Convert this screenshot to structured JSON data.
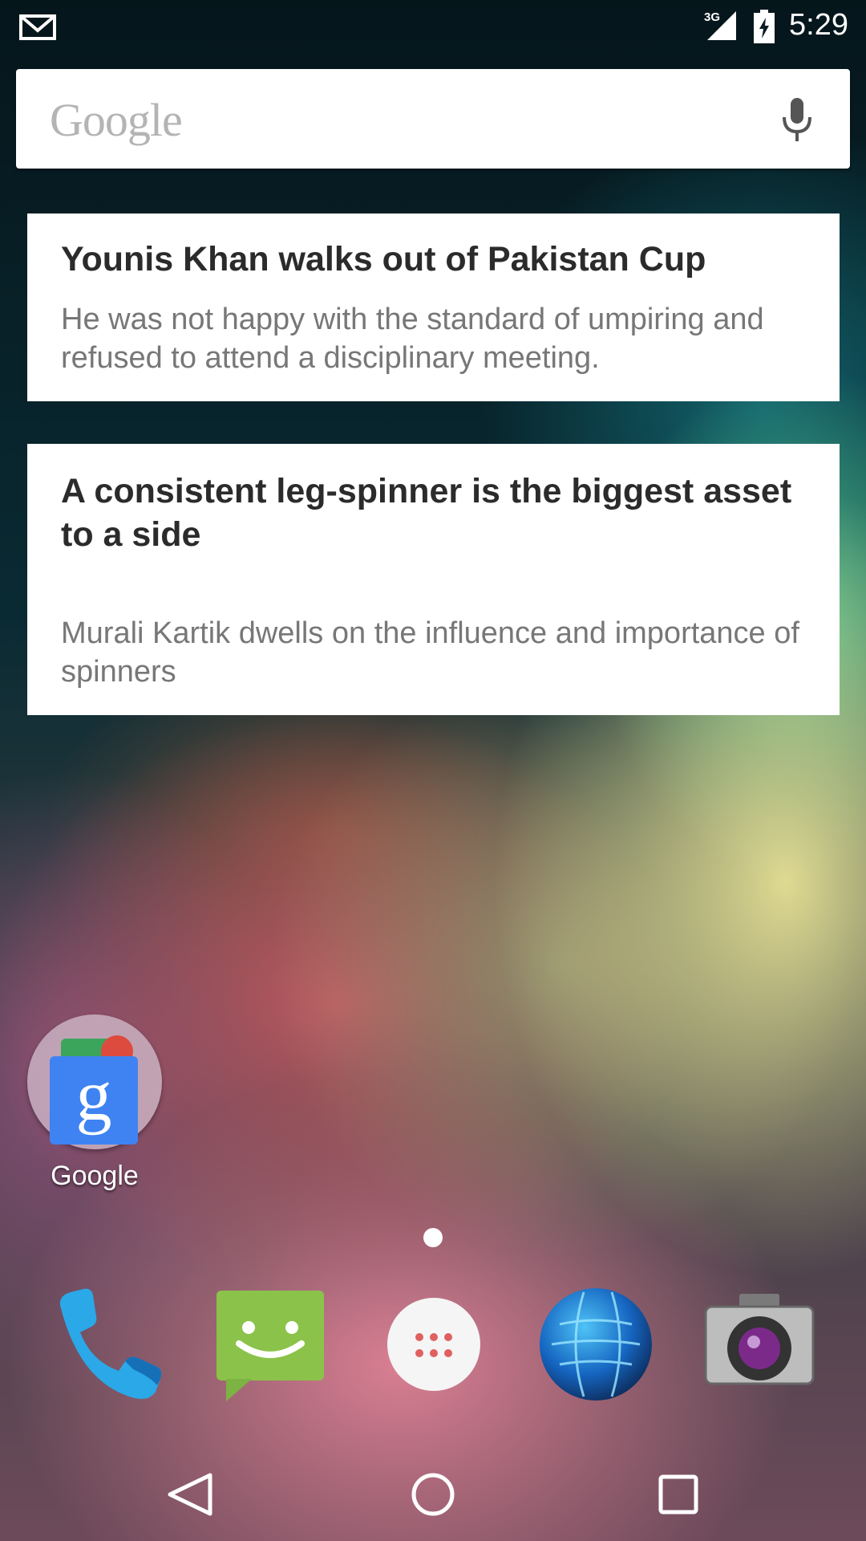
{
  "status_bar": {
    "network": "3G",
    "time": "5:29",
    "icons": [
      "mail-icon",
      "signal-icon",
      "battery-icon"
    ]
  },
  "search": {
    "logo_text": "Google",
    "icons": [
      "mic-icon"
    ]
  },
  "news_cards": [
    {
      "title": "Younis Khan walks out of Pakistan Cup",
      "text": "He was not happy with the standard of umpiring and refused to attend a disciplinary meeting."
    },
    {
      "title": "A consistent leg-spinner is the biggest asset to a side",
      "text": "Murali Kartik dwells on the influence and importance of spinners"
    }
  ],
  "home": {
    "folder_label": "Google",
    "folder_glyph": "g"
  },
  "dock": [
    "phone-icon",
    "messenger-icon",
    "apps-icon",
    "browser-icon",
    "camera-icon"
  ],
  "navigation": [
    "back-icon",
    "home-icon",
    "recents-icon"
  ],
  "colors": {
    "card_bg": "#ffffff",
    "title_text": "#2b2b2b",
    "body_text": "#777777",
    "google_blue": "#3f83f3",
    "message_green": "#8bc34a",
    "phone_blue": "#2aa8e8"
  }
}
